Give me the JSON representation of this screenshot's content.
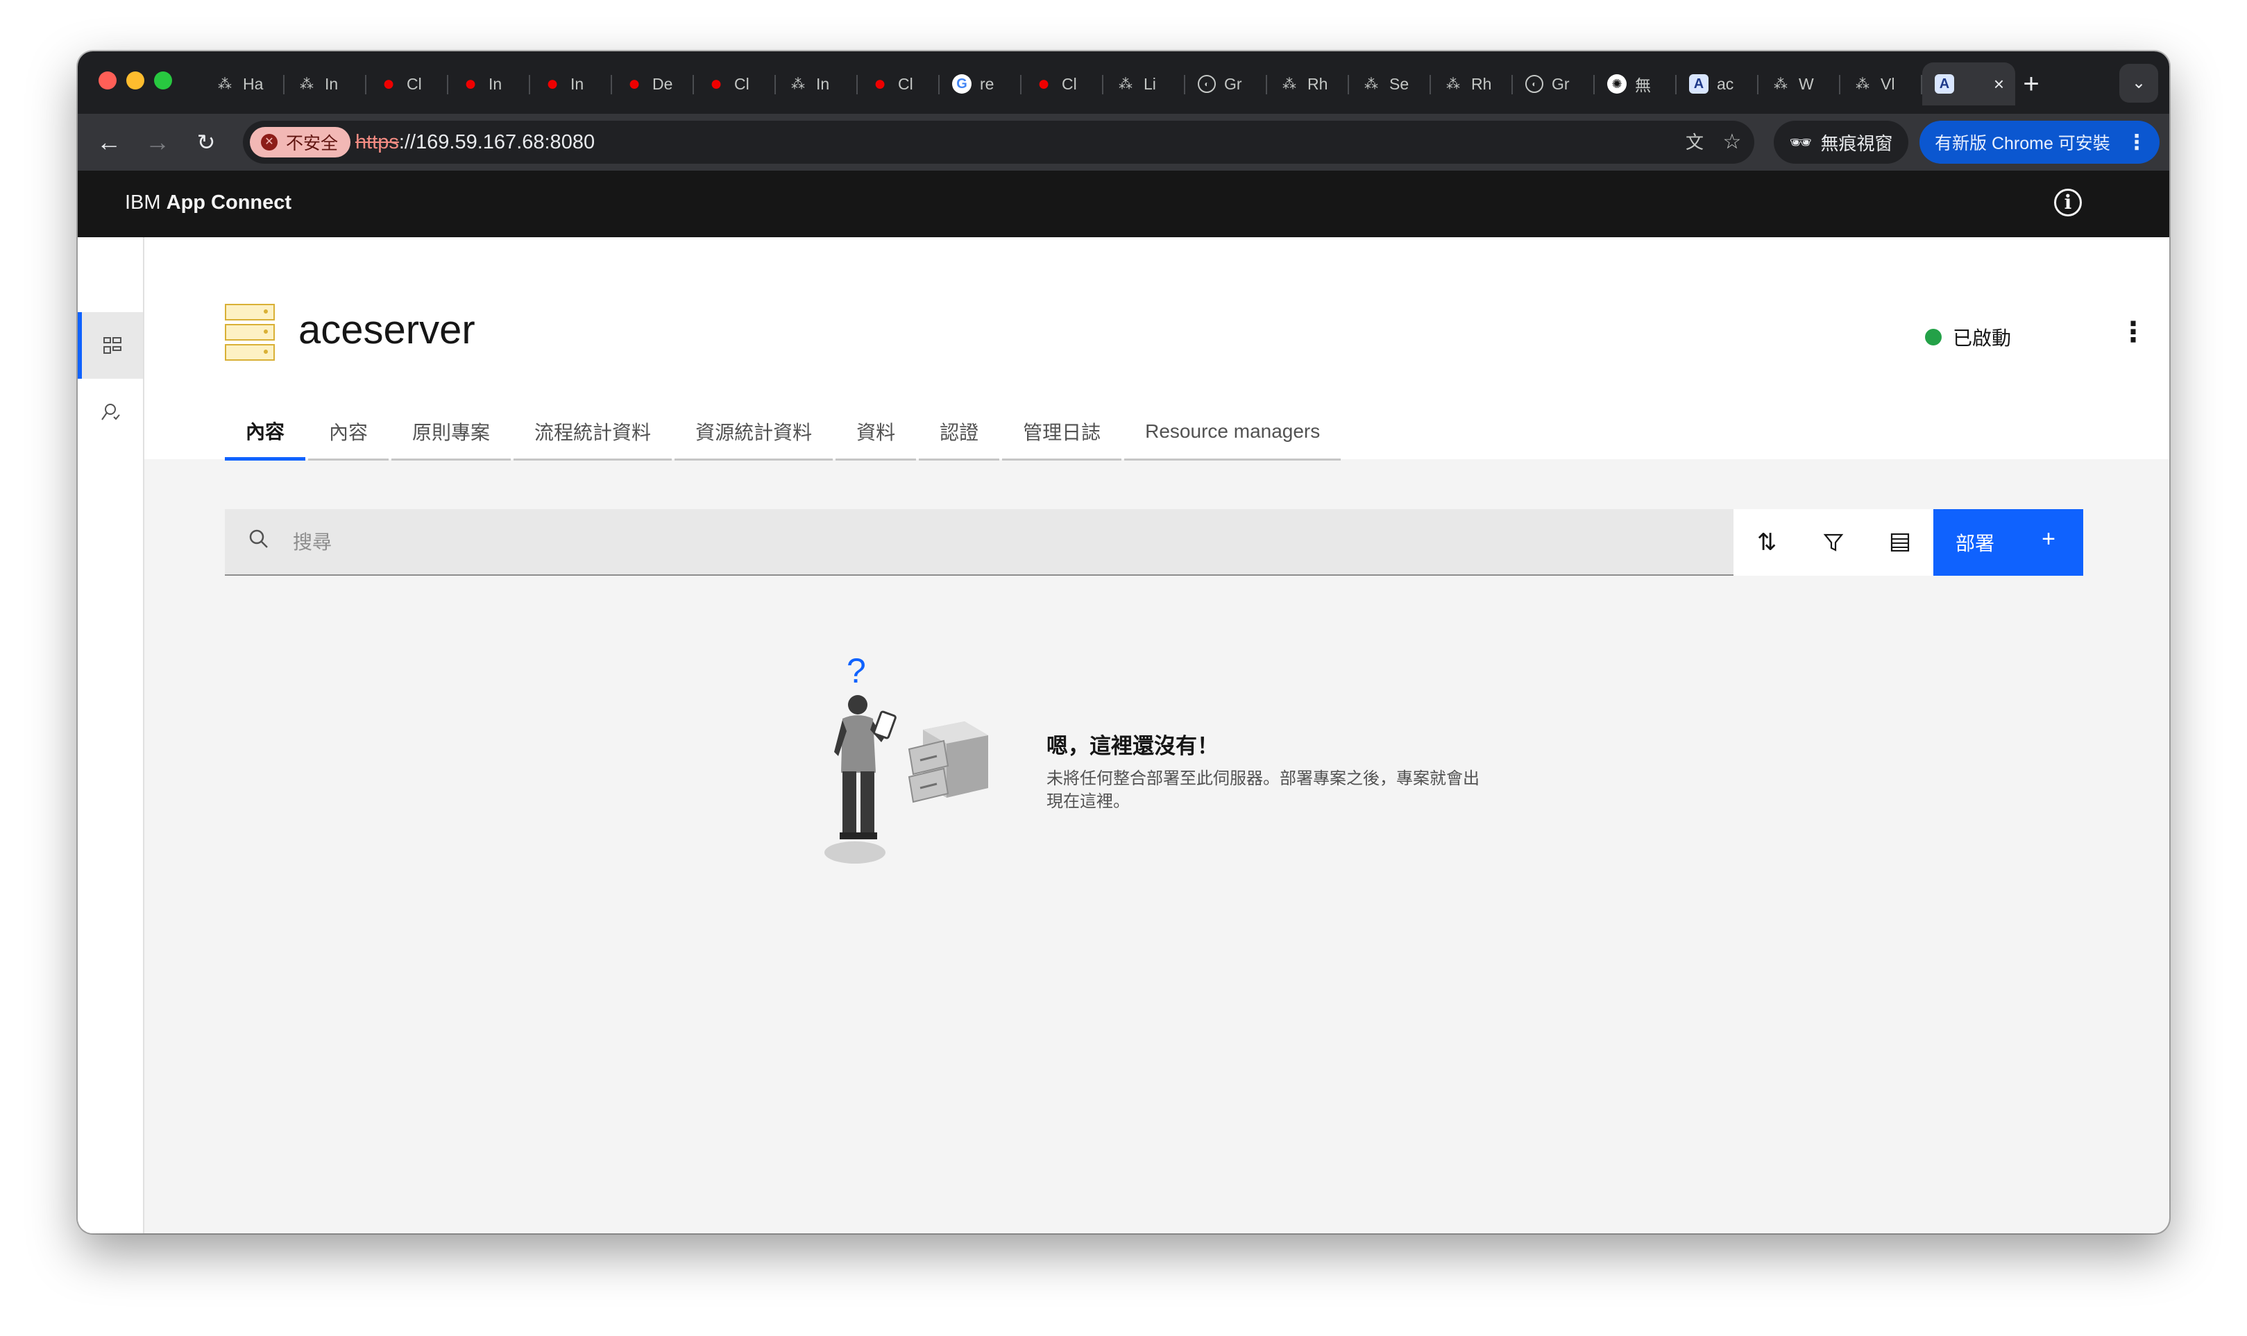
{
  "browser": {
    "tabs": [
      {
        "icon": "openshift-icon",
        "title": "Ha"
      },
      {
        "icon": "openshift-icon",
        "title": "In"
      },
      {
        "icon": "redhat-icon",
        "title": "Cl"
      },
      {
        "icon": "redhat-icon",
        "title": "In"
      },
      {
        "icon": "redhat-icon",
        "title": "In"
      },
      {
        "icon": "redhat-icon",
        "title": "De"
      },
      {
        "icon": "redhat-icon",
        "title": "Cl"
      },
      {
        "icon": "openshift-icon",
        "title": "In"
      },
      {
        "icon": "redhat-icon",
        "title": "Cl"
      },
      {
        "icon": "google-icon",
        "title": "re"
      },
      {
        "icon": "redhat-icon",
        "title": "Cl"
      },
      {
        "icon": "openshift-icon",
        "title": "Li"
      },
      {
        "icon": "github-icon",
        "title": "Gr"
      },
      {
        "icon": "openshift-icon",
        "title": "Rh"
      },
      {
        "icon": "openshift-icon",
        "title": "Se"
      },
      {
        "icon": "openshift-icon",
        "title": "Rh"
      },
      {
        "icon": "github-icon",
        "title": "Gr"
      },
      {
        "icon": "openai-icon",
        "title": "無"
      },
      {
        "icon": "ibm-ace-icon",
        "title": "ac"
      },
      {
        "icon": "openshift-icon",
        "title": "W"
      },
      {
        "icon": "openshift-icon",
        "title": "Vl"
      }
    ],
    "active_tab_icon": "ibm-ace-icon",
    "security_label": "不安全",
    "url_scheme": "https",
    "url_rest": "://169.59.167.68:8080",
    "incognito_label": "無痕視窗",
    "update_label": "有新版 Chrome 可安裝"
  },
  "app": {
    "brand_prefix": "IBM",
    "brand_name": "App Connect"
  },
  "server": {
    "name": "aceserver",
    "status": "已啟動"
  },
  "page_tabs": [
    {
      "label": "內容",
      "active": true
    },
    {
      "label": "內容",
      "active": false
    },
    {
      "label": "原則專案",
      "active": false
    },
    {
      "label": "流程統計資料",
      "active": false
    },
    {
      "label": "資源統計資料",
      "active": false
    },
    {
      "label": "資料",
      "active": false
    },
    {
      "label": "認證",
      "active": false
    },
    {
      "label": "管理日誌",
      "active": false
    },
    {
      "label": "Resource managers",
      "active": false
    }
  ],
  "search": {
    "placeholder": "搜尋"
  },
  "deploy": {
    "label": "部署",
    "icon": "+"
  },
  "empty_state": {
    "title": "嗯，這裡還沒有！",
    "description": "未將任何整合部署至此伺服器。部署專案之後，專案就會出現在這裡。"
  },
  "colors": {
    "accent": "#0f62fe",
    "status_ok": "#24a148",
    "header_bg": "#161616",
    "insecure_bg": "#f2b8b5",
    "update_bg": "#0b57d0"
  }
}
